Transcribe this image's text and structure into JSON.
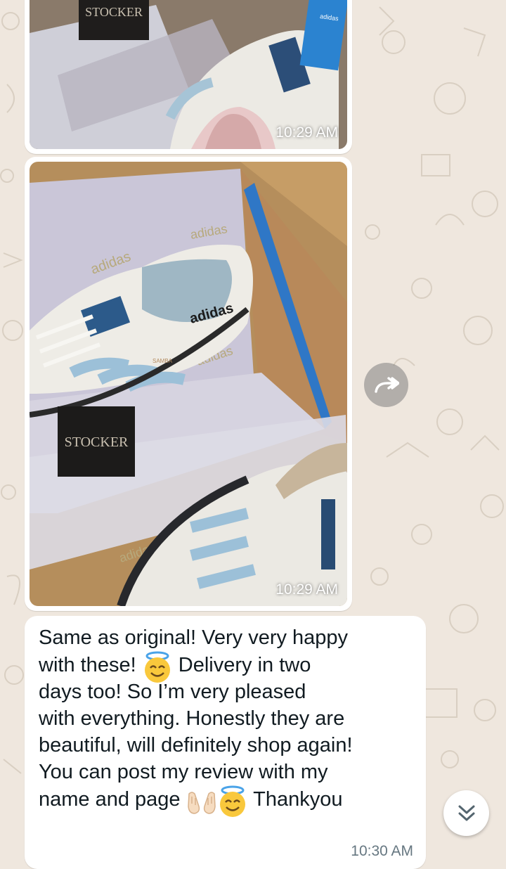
{
  "colors": {
    "background": "#efe7de",
    "bubble": "#ffffff",
    "text": "#111b21",
    "timestamp": "#667781"
  },
  "messages": [
    {
      "type": "image",
      "time": "10:29 AM",
      "tag": "STOCKER",
      "brand": "adidas"
    },
    {
      "type": "image",
      "time": "10:29 AM",
      "tag": "STOCKER",
      "brand": "adidas",
      "model": "SAMBA"
    },
    {
      "type": "text",
      "lines": [
        "Same as original! Very very happy",
        "with these!",
        "Delivery in two",
        "days too! So I’m very pleased",
        "with everything. Honestly they are",
        "beautiful, will definitely shop again!",
        "You can post my review with my",
        "name and page",
        "Thankyou"
      ],
      "emoji": [
        "smiling-face-with-halo",
        "palms-up-together",
        "smiling-face-with-halo"
      ],
      "time": "10:30 AM"
    }
  ],
  "controls": {
    "forward_icon": "forward-icon",
    "scroll_down_icon": "double-chevron-down-icon"
  }
}
